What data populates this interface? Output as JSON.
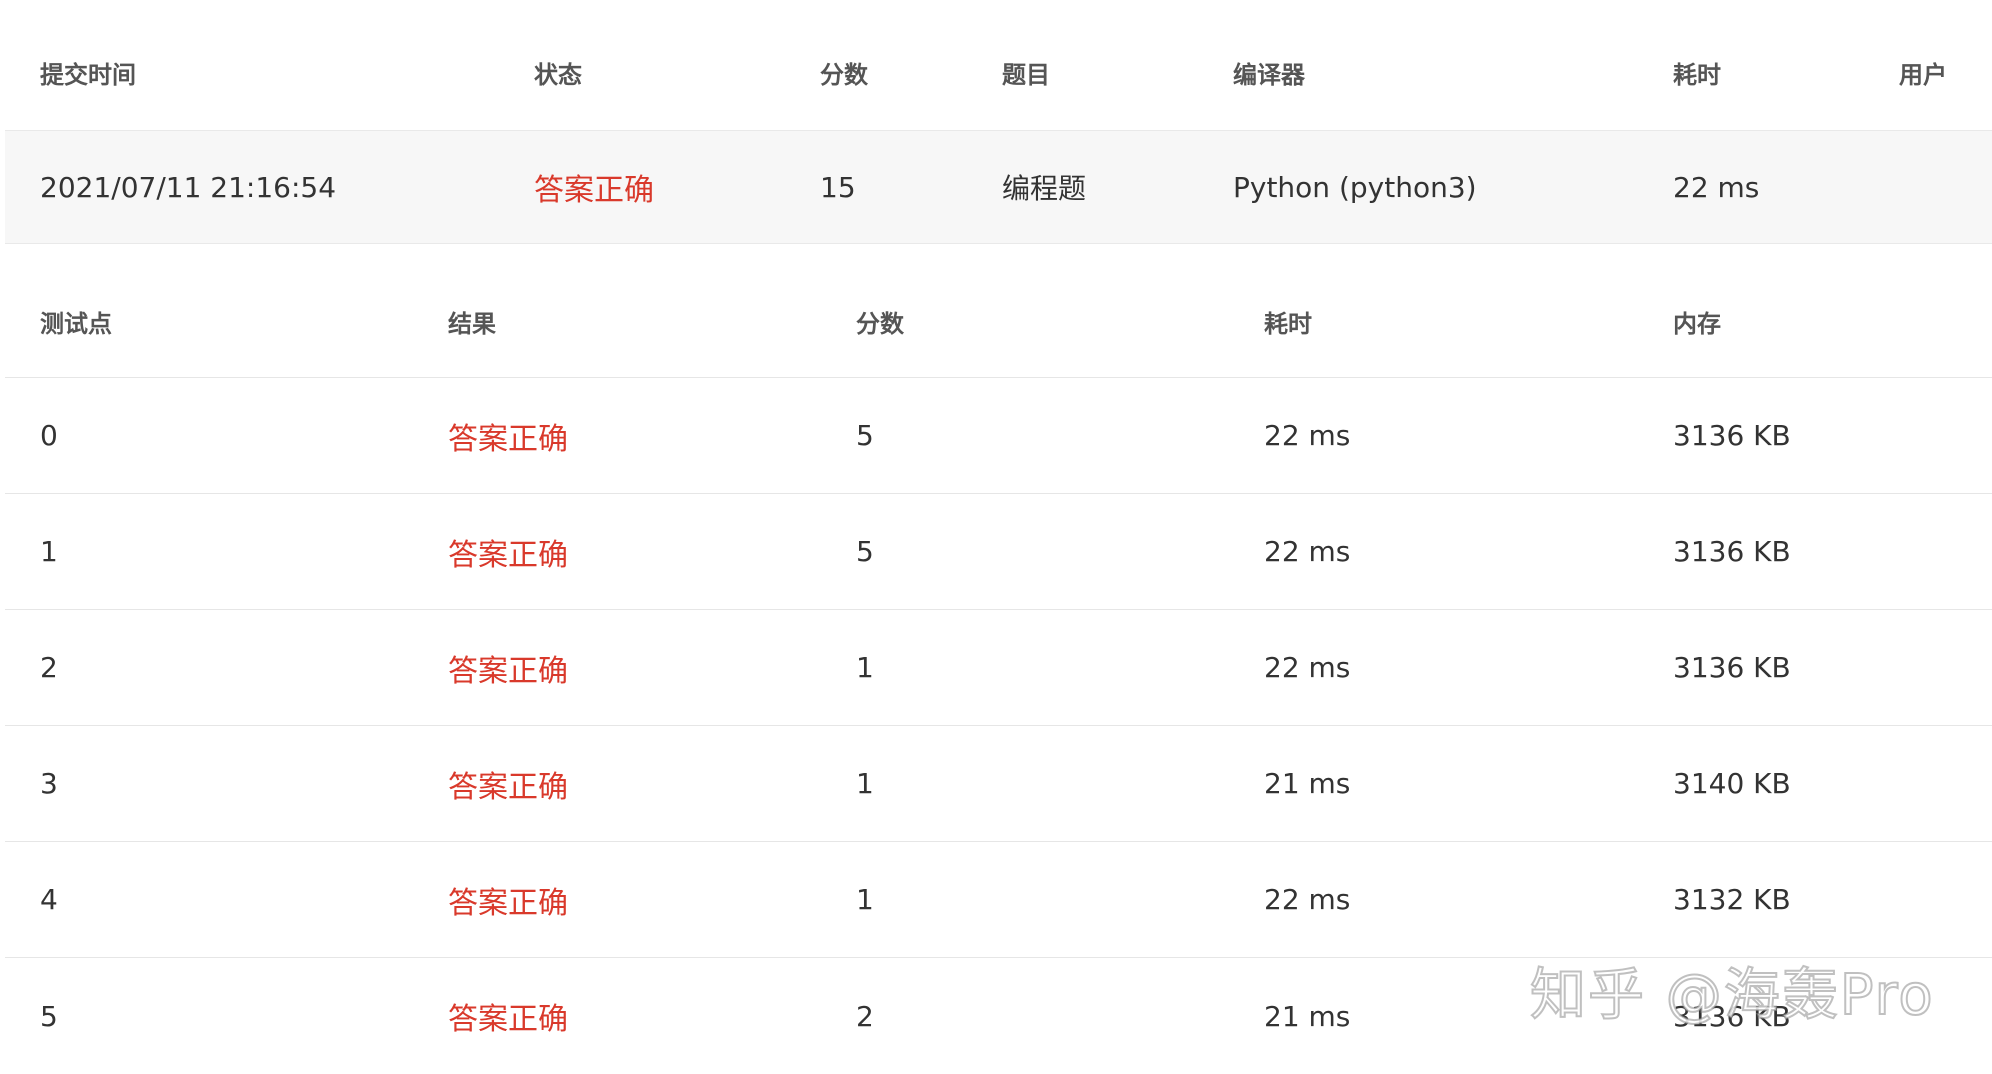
{
  "submission": {
    "headers": [
      "提交时间",
      "状态",
      "分数",
      "题目",
      "编译器",
      "耗时",
      "用户"
    ],
    "row": {
      "time": "2021/07/11 21:16:54",
      "status": "答案正确",
      "score": "15",
      "problem": "编程题",
      "compiler": "Python (python3)",
      "duration": "22 ms",
      "user": ""
    }
  },
  "testcases": {
    "headers": [
      "测试点",
      "结果",
      "分数",
      "耗时",
      "内存"
    ],
    "rows": [
      {
        "id": "0",
        "result": "答案正确",
        "score": "5",
        "time": "22 ms",
        "memory": "3136 KB"
      },
      {
        "id": "1",
        "result": "答案正确",
        "score": "5",
        "time": "22 ms",
        "memory": "3136 KB"
      },
      {
        "id": "2",
        "result": "答案正确",
        "score": "1",
        "time": "22 ms",
        "memory": "3136 KB"
      },
      {
        "id": "3",
        "result": "答案正确",
        "score": "1",
        "time": "21 ms",
        "memory": "3140 KB"
      },
      {
        "id": "4",
        "result": "答案正确",
        "score": "1",
        "time": "22 ms",
        "memory": "3132 KB"
      },
      {
        "id": "5",
        "result": "答案正确",
        "score": "2",
        "time": "21 ms",
        "memory": "3136 KB"
      }
    ]
  },
  "watermark": {
    "text": "知乎 @海轰Pro"
  },
  "colors": {
    "accepted": "#d9392b",
    "row_highlight": "#f7f7f7",
    "divider": "#e6e6e6"
  }
}
